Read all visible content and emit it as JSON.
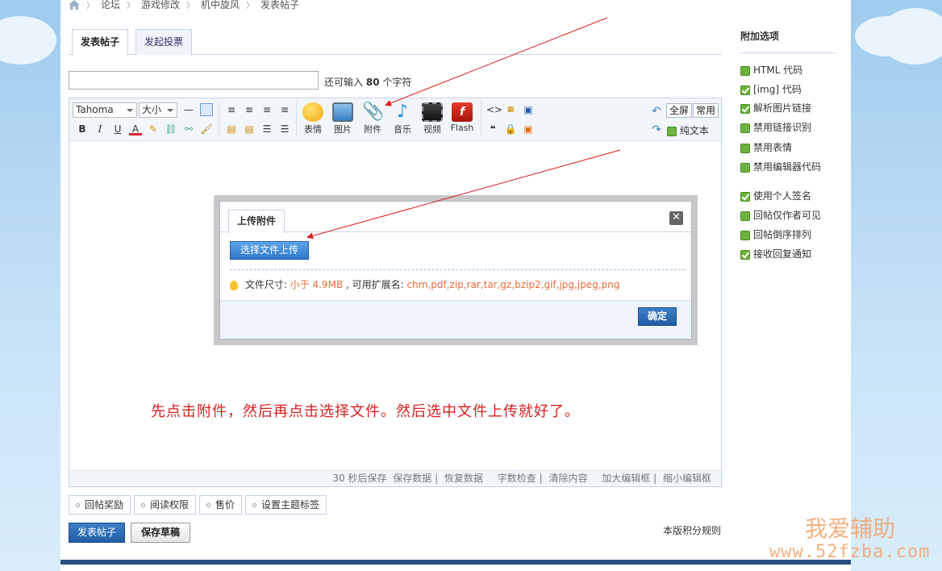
{
  "breadcrumb": [
    "论坛",
    "游戏修改",
    "机中旋风",
    "发表帖子"
  ],
  "tabs": [
    "发表帖子",
    "发起投票"
  ],
  "title_field": {
    "value": "",
    "hint_prefix": "还可输入",
    "hint_count": "80",
    "hint_suffix": "个字符"
  },
  "toolbar": {
    "font": "Tahoma",
    "size": "大小",
    "big_buttons": [
      "表情",
      "图片",
      "附件",
      "音乐",
      "视频",
      "Flash"
    ],
    "fullscreen": "全屏",
    "common": "常用",
    "plaintext": "纯文本"
  },
  "statusbar": {
    "autosave": "30 秒后保存",
    "save": "保存数据",
    "restore": "恢复数据",
    "count": "字数检查",
    "clear": "清除内容",
    "enlarge": "加大编辑框",
    "shrink": "缩小编辑框"
  },
  "dialog": {
    "tab": "上传附件",
    "choose": "选择文件上传",
    "size_label": "文件尺寸:",
    "size_value": "小于 4.9MB",
    "ext_label": ", 可用扩展名:",
    "ext_value": "chm,pdf,zip,rar,tar,gz,bzip2,gif,jpg,jpeg,png",
    "ok": "确定"
  },
  "annotation": "先点击附件，然后再点击选择文件。然后选中文件上传就好了。",
  "options": [
    "回帖奖励",
    "阅读权限",
    "售价",
    "设置主题标签"
  ],
  "actions": {
    "submit": "发表帖子",
    "draft": "保存草稿",
    "rules": "本版积分规则"
  },
  "sidebar": {
    "title": "附加选项",
    "items": [
      {
        "label": "HTML 代码",
        "checked": false
      },
      {
        "label": "[img] 代码",
        "checked": true
      },
      {
        "label": "解析图片链接",
        "checked": true
      },
      {
        "label": "禁用链接识别",
        "checked": false
      },
      {
        "label": "禁用表情",
        "checked": false
      },
      {
        "label": "禁用编辑器代码",
        "checked": false
      },
      {
        "label": "使用个人签名",
        "checked": true
      },
      {
        "label": "回帖仅作者可见",
        "checked": false
      },
      {
        "label": "回帖倒序排列",
        "checked": false
      },
      {
        "label": "接收回复通知",
        "checked": true
      }
    ]
  },
  "watermark": {
    "name": "我爱辅助",
    "url": "www.52fzba.com"
  },
  "colors": {
    "accent": "#2d78c8",
    "annotation": "#d81e1e",
    "note": "#e96b3c"
  }
}
